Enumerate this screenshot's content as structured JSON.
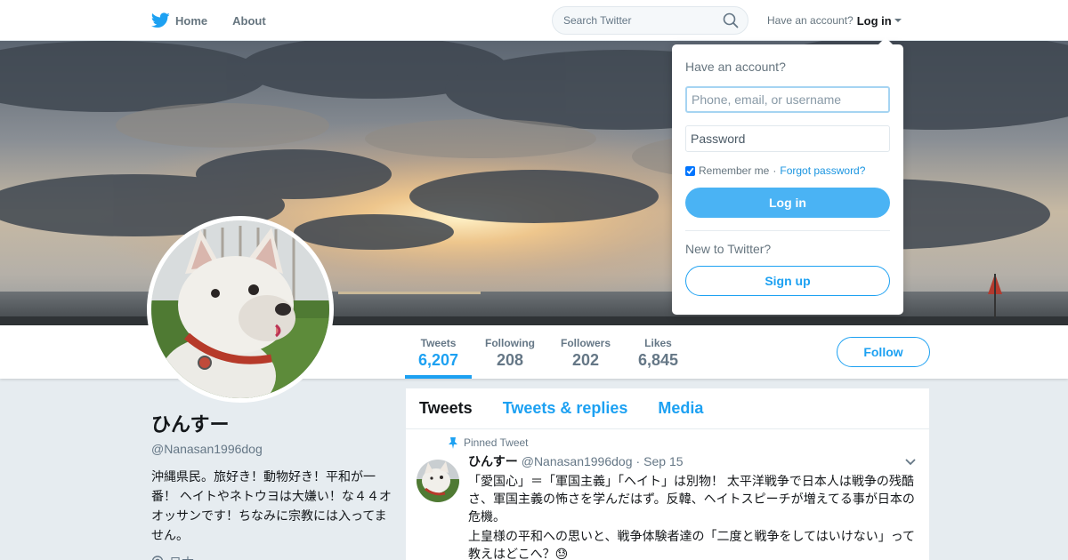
{
  "nav": {
    "home_label": "Home",
    "about_label": "About",
    "search_placeholder": "Search Twitter",
    "have_account": "Have an account?",
    "login_label": "Log in"
  },
  "profile_nav": {
    "stats": [
      {
        "label": "Tweets",
        "value": "6,207"
      },
      {
        "label": "Following",
        "value": "208"
      },
      {
        "label": "Followers",
        "value": "202"
      },
      {
        "label": "Likes",
        "value": "6,845"
      }
    ],
    "follow_label": "Follow"
  },
  "profile": {
    "name": "ひんすー",
    "handle": "@Nanasan1996dog",
    "bio": "沖縄県民。旅好き！動物好き！平和が一番！ ヘイトやネトウヨは大嫌い！な４４オオッサンです！ちなみに宗教には入ってません。",
    "location": "日本"
  },
  "timeline": {
    "tabs": [
      "Tweets",
      "Tweets & replies",
      "Media"
    ],
    "tweet": {
      "pinned_label": "Pinned Tweet",
      "name": "ひんすー",
      "handle": "@Nanasan1996dog",
      "separator": "·",
      "date": "Sep 15",
      "text_line1": "「愛国心」＝「軍国主義」「ヘイト」は別物！ 太平洋戦争で日本人は戦争の残酷さ、軍国主義の怖さを学んだはず。反韓、ヘイトスピーチが増えてる事が日本の危機。",
      "text_line2": "上皇様の平和への思いと、戦争体験者達の「二度と戦争をしてはいけない」って教えはどこへ？😓"
    }
  },
  "login_dropdown": {
    "title": "Have an account?",
    "username_placeholder": "Phone, email, or username",
    "password_placeholder": "Password",
    "remember_label": "Remember me",
    "separator": "·",
    "forgot_label": "Forgot password?",
    "login_button": "Log in",
    "new_label": "New to Twitter?",
    "signup_button": "Sign up"
  },
  "colors": {
    "accent": "#1da1f2",
    "login_button": "#4ab3f4"
  }
}
